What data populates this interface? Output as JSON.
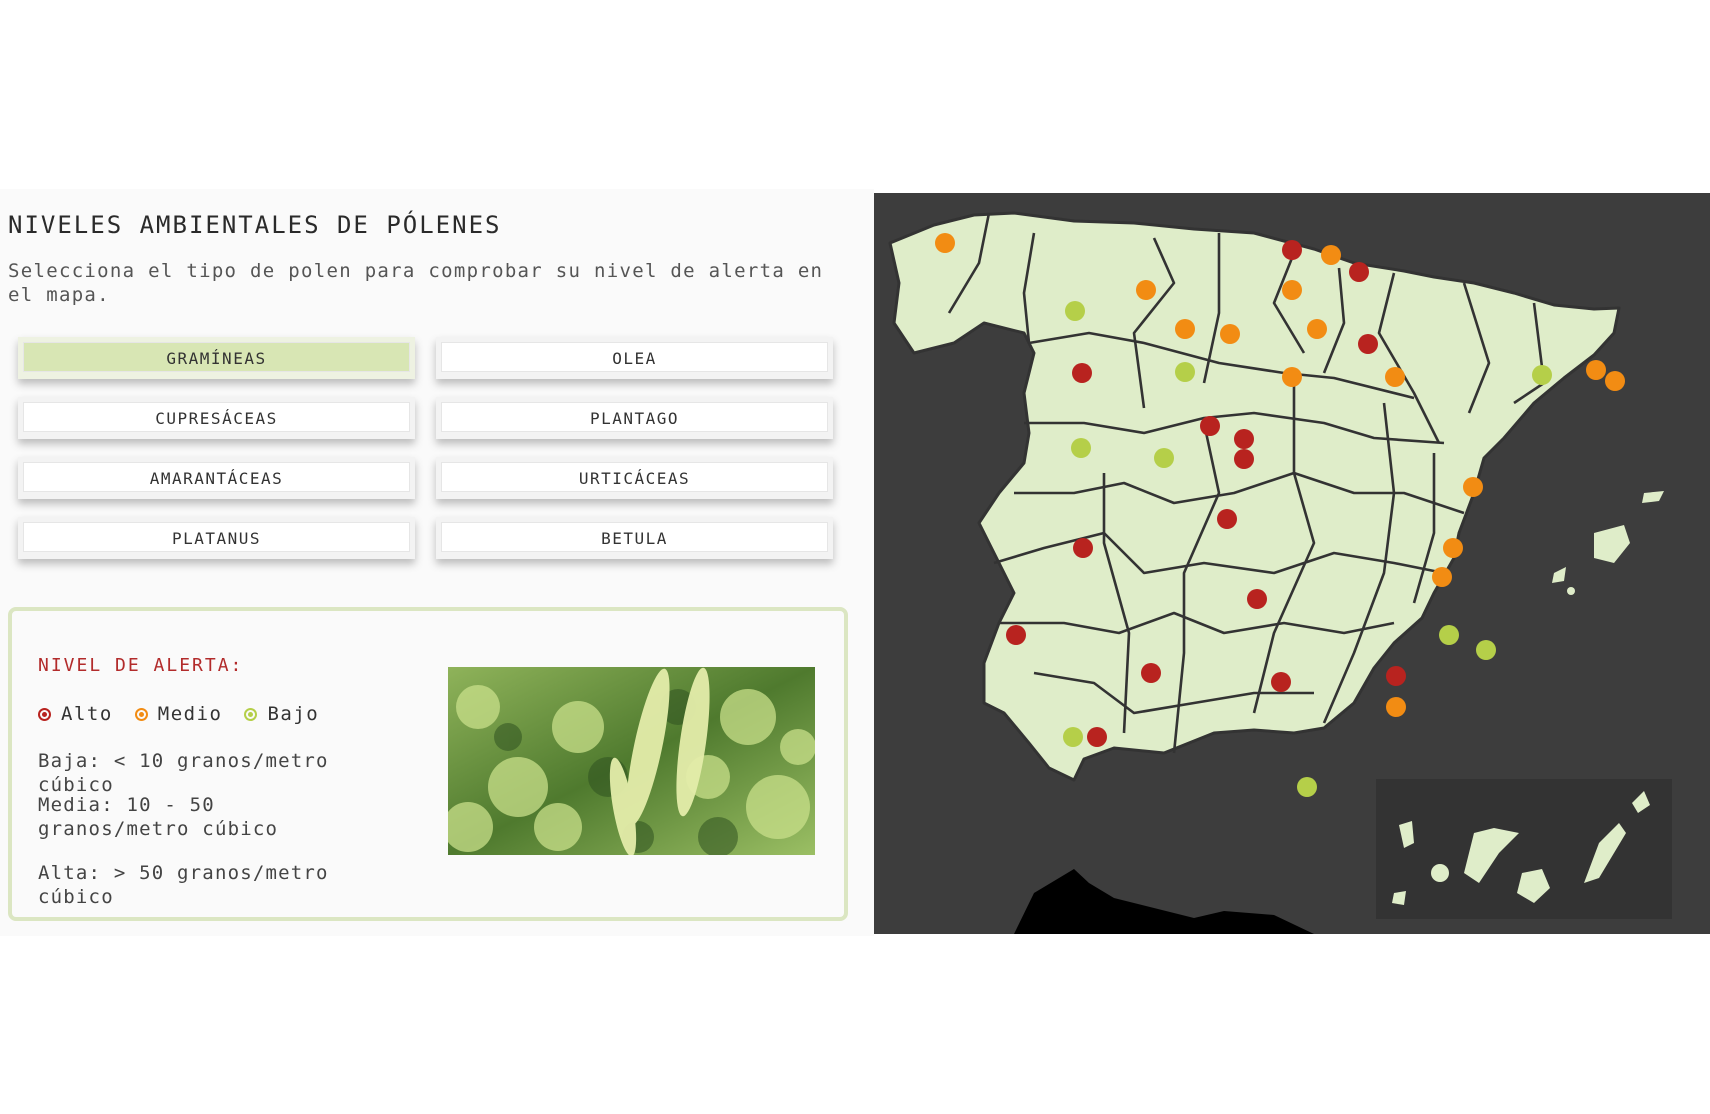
{
  "header": {
    "title": "NIVELES AMBIENTALES DE PÓLENES",
    "subtitle": "Selecciona el tipo de polen para comprobar su nivel de alerta en el mapa."
  },
  "pollen_types": [
    {
      "label": "GRAMÍNEAS",
      "active": true
    },
    {
      "label": "OLEA",
      "active": false
    },
    {
      "label": "CUPRESÁCEAS",
      "active": false
    },
    {
      "label": "PLANTAGO",
      "active": false
    },
    {
      "label": "AMARANTÁCEAS",
      "active": false
    },
    {
      "label": "URTICÁCEAS",
      "active": false
    },
    {
      "label": "PLATANUS",
      "active": false
    },
    {
      "label": "BETULA",
      "active": false
    }
  ],
  "alert": {
    "title": "NIVEL DE ALERTA:",
    "legend": [
      {
        "label": "Alto",
        "color": "#b8231f"
      },
      {
        "label": "Medio",
        "color": "#f28c13"
      },
      {
        "label": "Bajo",
        "color": "#b5cf49"
      }
    ],
    "levels": [
      "Baja: < 10 granos/metro cúbico",
      "Media: 10 - 50 granos/metro cúbico",
      "Alta: > 50 granos/metro cúbico"
    ]
  },
  "map": {
    "land_color": "#dfedc9",
    "sea_color": "#3d3d3d",
    "inset_color": "#333333",
    "points": [
      {
        "level": "medio"
      },
      {
        "level": "alto"
      },
      {
        "level": "medio"
      },
      {
        "level": "alto"
      },
      {
        "level": "medio"
      },
      {
        "level": "bajo"
      },
      {
        "level": "medio"
      },
      {
        "level": "medio"
      },
      {
        "level": "medio"
      },
      {
        "level": "medio"
      },
      {
        "level": "alto"
      },
      {
        "level": "alto"
      },
      {
        "level": "bajo"
      },
      {
        "level": "medio"
      },
      {
        "level": "medio"
      },
      {
        "level": "bajo"
      },
      {
        "level": "medio"
      },
      {
        "level": "medio"
      },
      {
        "level": "bajo"
      },
      {
        "level": "alto"
      },
      {
        "level": "alto"
      },
      {
        "level": "alto"
      },
      {
        "level": "bajo"
      },
      {
        "level": "medio"
      },
      {
        "level": "alto"
      },
      {
        "level": "alto"
      },
      {
        "level": "medio"
      },
      {
        "level": "medio"
      },
      {
        "level": "alto"
      },
      {
        "level": "alto"
      },
      {
        "level": "bajo"
      },
      {
        "level": "alto"
      },
      {
        "level": "alto"
      },
      {
        "level": "bajo"
      },
      {
        "level": "alto"
      },
      {
        "level": "medio"
      },
      {
        "level": "bajo"
      },
      {
        "level": "alto"
      },
      {
        "level": "bajo"
      }
    ]
  }
}
